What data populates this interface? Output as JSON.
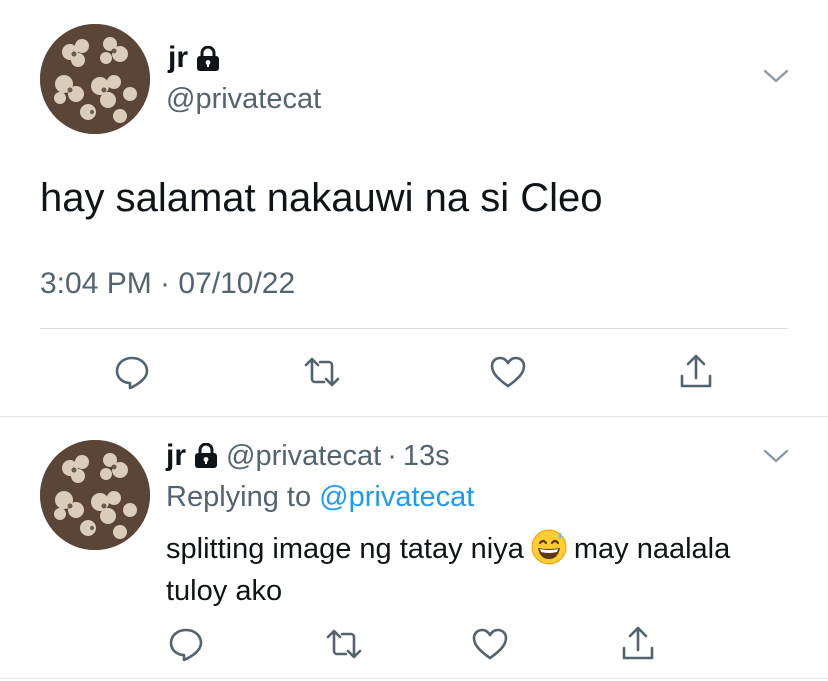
{
  "main_tweet": {
    "author_name": "jr",
    "author_handle": "@privatecat",
    "text": "hay salamat nakauwi na si Cleo",
    "timestamp": "3:04 PM · 07/10/22",
    "icons": [
      "lock-icon",
      "chevron-down-icon",
      "reply-icon",
      "retweet-icon",
      "like-icon",
      "share-icon"
    ]
  },
  "reply_tweet": {
    "author_name": "jr",
    "author_handle": "@privatecat",
    "separator": "·",
    "time_ago": "13s",
    "replying_prefix": "Replying to",
    "replying_to": "@privatecat",
    "text_before_emoji": "splitting image ng tatay niya",
    "emoji": "grinning-face-with-sweat",
    "text_after_emoji": "may naalala tuloy ako"
  },
  "colors": {
    "text": "#0f1419",
    "secondary": "#536471",
    "link": "#1d9bf0",
    "divider": "#d9dde1"
  }
}
